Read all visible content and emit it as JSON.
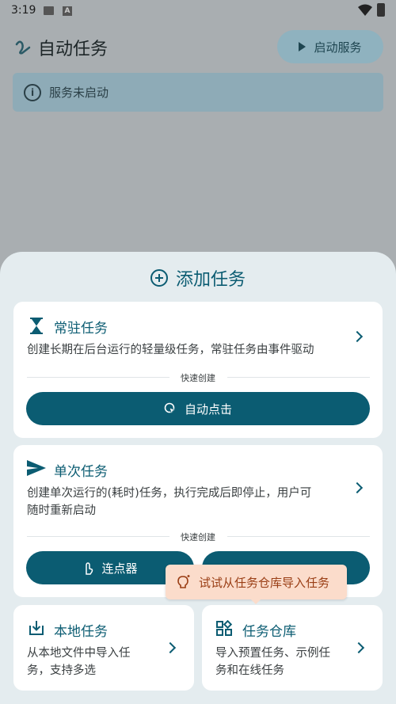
{
  "status_bar": {
    "time": "3:19",
    "a_badge": "A"
  },
  "app_bar": {
    "title": "自动任务",
    "start_service_label": "启动服务"
  },
  "banner": {
    "text": "服务未启动"
  },
  "sheet": {
    "title": "添加任务",
    "resident": {
      "title": "常驻任务",
      "description": "创建长期在后台运行的轻量级任务，常驻任务由事件驱动",
      "quick_label": "快速创建",
      "quick_button": "自动点击"
    },
    "oneshot": {
      "title": "单次任务",
      "description_line1": "创建单次运行的(耗时)任务，执行完成后即停止，用户可",
      "description_line2": "随时重新启动",
      "quick_label": "快速创建",
      "quick_button": "连点器"
    },
    "local": {
      "title": "本地任务",
      "description_line1": "从本地文件中导入任",
      "description_line2": "务，支持多选"
    },
    "repo": {
      "title": "任务仓库",
      "description_line1": "导入预置任务、示例任",
      "description_line2": "务和在线任务"
    },
    "tooltip": "试试从任务仓库导入任务"
  },
  "colors": {
    "accent": "#0b5c72",
    "sheet_bg": "#e4ecef",
    "tooltip_bg": "#fbdccb",
    "tooltip_text": "#9a3e15"
  }
}
